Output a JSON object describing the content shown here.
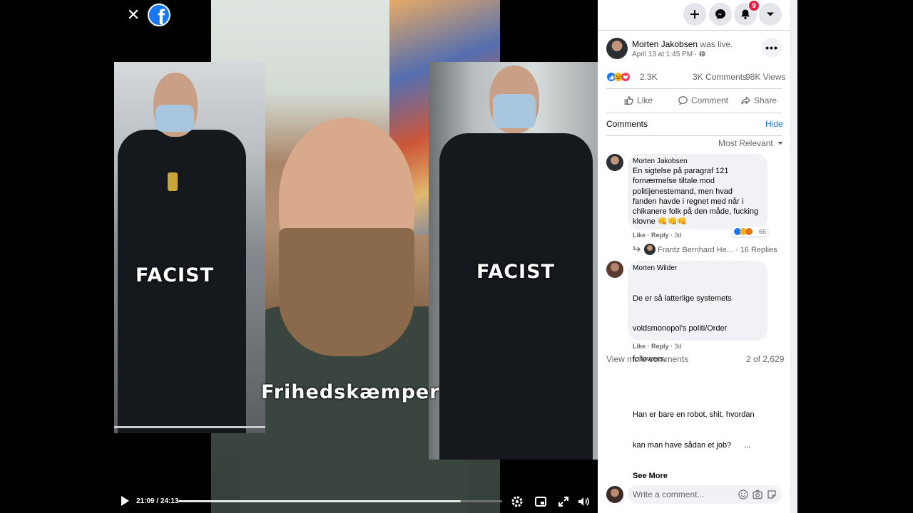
{
  "viewer": {
    "close_label": "✕",
    "logo_letter": "f",
    "captions": {
      "left": "FACIST",
      "center": "Frihedskæmper",
      "right": "FACIST"
    },
    "controls": {
      "time": "21:09 / 24:13",
      "progress": 0.873
    }
  },
  "topbar": {
    "notification_count": "9"
  },
  "post": {
    "author": "Morten Jakobsen",
    "status": "was live.",
    "meta": "April 13 at 1:45 PM ·",
    "reaction_count": "2.3K",
    "comments_count": "3K Comments",
    "views": "98K Views",
    "actions": {
      "like": "Like",
      "comment": "Comment",
      "share": "Share"
    }
  },
  "comments_section": {
    "title": "Comments",
    "hide": "Hide",
    "sort": "Most Relevant",
    "view_more": "View more comments",
    "count": "2 of 2,629",
    "write_placeholder": "Write a comment..."
  },
  "comments": [
    {
      "author": "Morten Jakobsen",
      "lines": [
        "En sigtelse på paragraf 121",
        "fornærmelse tiltale mod",
        "politijenestemand, men hvad",
        "fanden havde i regnet med når i",
        "chikanere folk på den måde, fucking",
        "klovne 👊👊👊"
      ],
      "reactions": "66",
      "like": "Like",
      "reply": "Reply",
      "age": "3d",
      "reply_preview": "Frantz Bernhard He...",
      "replies": "· 16 Replies"
    },
    {
      "author": "Morten Wilder",
      "lines": [
        "De er så latterlige systemets",
        "voldsmonopol's politi/Order",
        "followers."
      ],
      "lines2": [
        "Han er bare en robot, shit, hvordan",
        "kan man have sådan et job?      ..."
      ],
      "see_more": "See More",
      "like": "Like",
      "reply": "Reply",
      "age": "3d"
    }
  ],
  "colors": {
    "accent": "#1877f2",
    "badge": "#e41e3f"
  }
}
